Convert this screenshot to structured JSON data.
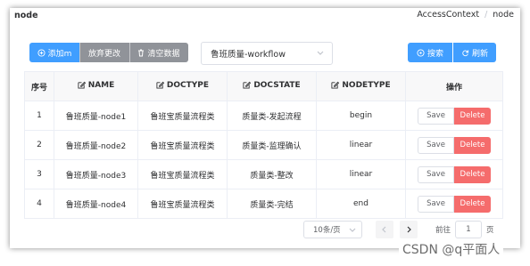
{
  "page": {
    "title": "node"
  },
  "breadcrumb": {
    "items": [
      "AccessContext",
      "node"
    ],
    "separator": "/"
  },
  "toolbar": {
    "add_label": "添加m",
    "discard_label": "放弃更改",
    "clear_label": "清空数据",
    "search_label": "搜索",
    "refresh_label": "刷新"
  },
  "workflow_select": {
    "value": "鲁班质量-workflow"
  },
  "table": {
    "headers": {
      "index": "序号",
      "name": "NAME",
      "doctype": "DOCTYPE",
      "docstate": "DOCSTATE",
      "nodetype": "NODETYPE",
      "actions": "操作"
    },
    "rows": [
      {
        "index": "1",
        "name": "鲁班质量-node1",
        "doctype": "鲁班宝质量流程类",
        "docstate": "质量类-发起流程",
        "nodetype": "begin"
      },
      {
        "index": "2",
        "name": "鲁班质量-node2",
        "doctype": "鲁班宝质量流程类",
        "docstate": "质量类-监理确认",
        "nodetype": "linear"
      },
      {
        "index": "3",
        "name": "鲁班质量-node3",
        "doctype": "鲁班宝质量流程类",
        "docstate": "质量类-整改",
        "nodetype": "linear"
      },
      {
        "index": "4",
        "name": "鲁班质量-node4",
        "doctype": "鲁班宝质量流程类",
        "docstate": "质量类-完结",
        "nodetype": "end"
      }
    ],
    "save_label": "Save",
    "delete_label": "Delete"
  },
  "pagination": {
    "page_size": "10条/页",
    "goto_label": "前往",
    "current_page": "1",
    "page_unit": "页"
  },
  "watermark": "CSDN @q平面人",
  "colors": {
    "primary": "#409eff",
    "gray": "#909399",
    "danger": "#f56c6c"
  }
}
